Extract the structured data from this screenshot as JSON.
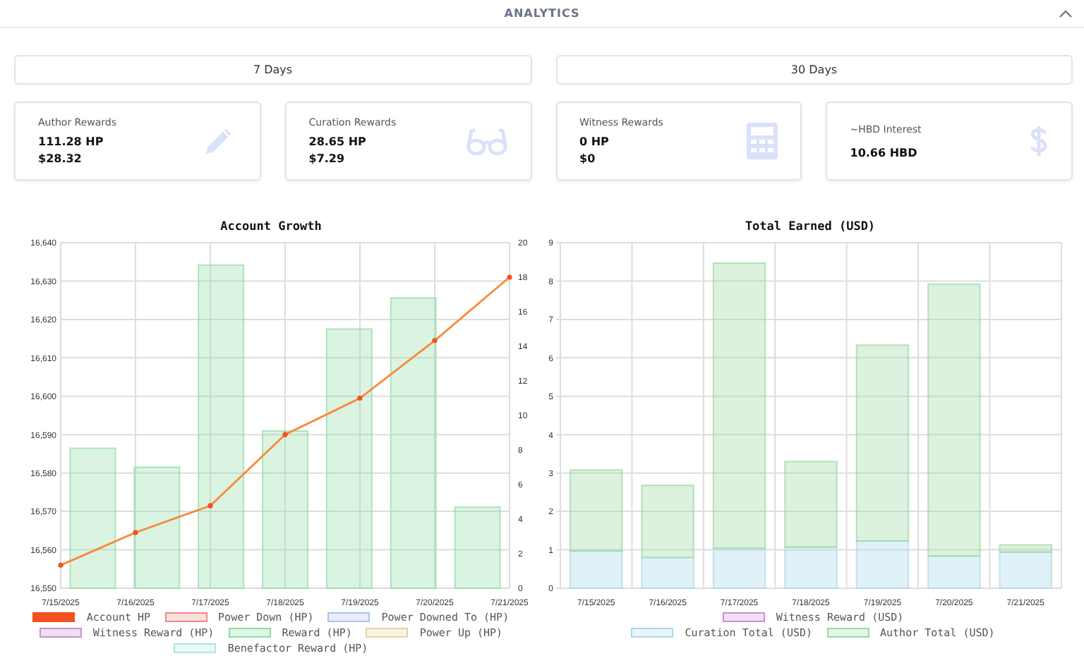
{
  "header": {
    "title": "ANALYTICS",
    "expanded": true
  },
  "ranges": [
    "7 Days",
    "30 Days"
  ],
  "cards": [
    {
      "title": "Author Rewards",
      "lines": [
        "111.28 HP",
        "$28.32"
      ],
      "kind": "pencil"
    },
    {
      "title": "Curation Rewards",
      "lines": [
        "28.65 HP",
        "$7.29"
      ],
      "kind": "glasses"
    },
    {
      "title": "Witness Rewards",
      "lines": [
        "0 HP",
        "$0"
      ],
      "kind": "calculator"
    },
    {
      "title": "~HBD Interest",
      "lines": [
        "10.66 HBD"
      ],
      "kind": "dollar"
    }
  ],
  "charts": [
    {
      "chart_data": {
        "type": "bar",
        "title": "Account Growth",
        "stacked": false,
        "grid": true,
        "categories": [
          "7/15/2025",
          "7/16/2025",
          "7/17/2025",
          "7/18/2025",
          "7/19/2025",
          "7/20/2025",
          "7/21/2025"
        ],
        "series": [
          {
            "name": "Account HP",
            "color": "#f4511e",
            "type": "line",
            "marker": true,
            "values": [
              16556,
              16564.5,
              16571.5,
              16590,
              16599.5,
              16614.5,
              16631
            ]
          },
          {
            "name": "Power Down (HP)",
            "color": "#f08a8a",
            "type": "bar",
            "values": [
              null,
              null,
              null,
              null,
              null,
              null,
              null
            ]
          },
          {
            "name": "Power Downed To (HP)",
            "color": "#a8c4f0",
            "type": "bar",
            "values": [
              null,
              null,
              null,
              null,
              null,
              null,
              null
            ]
          },
          {
            "name": "Witness Reward (HP)",
            "color": "#c890d0",
            "type": "bar",
            "values": [
              null,
              null,
              null,
              null,
              null,
              null,
              null
            ]
          },
          {
            "name": "Reward (HP)",
            "color": "#8fdca4",
            "type": "bar",
            "axis": "y2",
            "values": [
              8.1,
              7.0,
              18.7,
              9.1,
              15.0,
              16.8,
              4.7
            ]
          },
          {
            "name": "Power Up (HP)",
            "color": "#e4d49c",
            "type": "bar",
            "values": [
              null,
              null,
              null,
              null,
              null,
              null,
              null
            ]
          },
          {
            "name": "Benefactor Reward (HP)",
            "color": "#a8e8e0",
            "type": "bar",
            "values": [
              null,
              null,
              null,
              null,
              null,
              null,
              null
            ]
          }
        ],
        "ylim": [
          16550,
          16640
        ],
        "yticks": [
          {
            "value": 16550,
            "label": "16,550"
          },
          {
            "value": 16560,
            "label": "16,560"
          },
          {
            "value": 16570,
            "label": "16,570"
          },
          {
            "value": 16580,
            "label": "16,580"
          },
          {
            "value": 16590,
            "label": "16,590"
          },
          {
            "value": 16600,
            "label": "16,600"
          },
          {
            "value": 16610,
            "label": "16,610"
          },
          {
            "value": 16620,
            "label": "16,620"
          },
          {
            "value": 16630,
            "label": "16,630"
          },
          {
            "value": 16640,
            "label": "16,640"
          }
        ],
        "y2lim": [
          0,
          20
        ],
        "y2ticks": [
          0,
          2,
          4,
          6,
          8,
          10,
          12,
          14,
          16,
          18,
          20
        ]
      }
    },
    {
      "chart_data": {
        "type": "bar",
        "title": "Total Earned (USD)",
        "stacked": true,
        "grid": true,
        "categories": [
          "7/15/2025",
          "7/16/2025",
          "7/17/2025",
          "7/18/2025",
          "7/19/2025",
          "7/20/2025",
          "7/21/2025"
        ],
        "series": [
          {
            "name": "Witness Reward (USD)",
            "color": "#c890d0",
            "values": [
              null,
              null,
              null,
              null,
              null,
              null,
              null
            ]
          },
          {
            "name": "Curation Total (USD)",
            "color": "#a8d8ec",
            "values": [
              0.97,
              0.8,
              1.04,
              1.07,
              1.23,
              0.84,
              0.94
            ]
          },
          {
            "name": "Author Total (USD)",
            "color": "#9ad8a0",
            "values": [
              2.11,
              1.88,
              7.43,
              2.23,
              5.1,
              7.08,
              0.19
            ]
          }
        ],
        "ylim": [
          0,
          9
        ],
        "yticks": [
          0,
          1,
          2,
          3,
          4,
          5,
          6,
          7,
          8,
          9
        ]
      }
    }
  ]
}
